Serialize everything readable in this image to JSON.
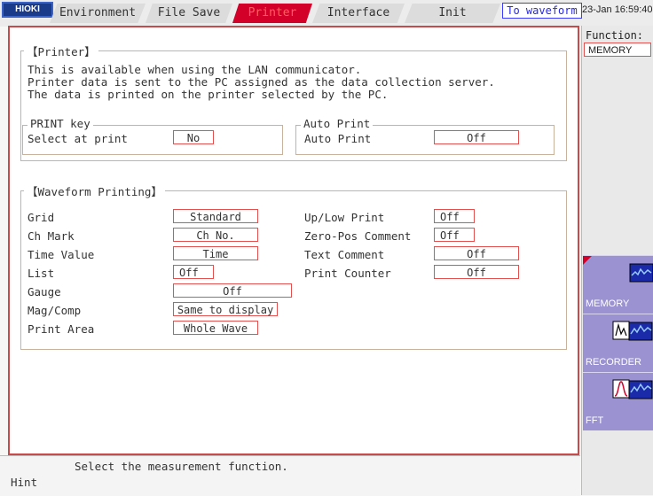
{
  "header": {
    "logo": "HIOKI",
    "tabs": [
      {
        "label": "Environment",
        "active": false
      },
      {
        "label": "File Save",
        "active": false
      },
      {
        "label": "Printer",
        "active": true
      },
      {
        "label": "Interface",
        "active": false
      },
      {
        "label": "Init",
        "active": false
      }
    ],
    "to_waveform": "To waveform",
    "clock": "23-Jan 16:59:40"
  },
  "printer": {
    "title": "【Printer】",
    "desc": [
      "This is available when using the LAN communicator.",
      "Printer data is sent to the PC assigned as the data collection server.",
      "The data is printed on the printer selected by the PC."
    ],
    "print_key": {
      "title": "PRINT key",
      "label": "Select at print",
      "value": "No"
    },
    "auto_print": {
      "title": "Auto Print",
      "label": "Auto Print",
      "value": "Off"
    }
  },
  "waveform": {
    "title": "【Waveform Printing】",
    "left": [
      {
        "label": "Grid",
        "value": "Standard"
      },
      {
        "label": "Ch Mark",
        "value": "Ch No."
      },
      {
        "label": "Time Value",
        "value": "Time"
      },
      {
        "label": "List",
        "value": "Off"
      },
      {
        "label": "Gauge",
        "value": "Off"
      },
      {
        "label": "Mag/Comp",
        "value": "Same to display"
      },
      {
        "label": "Print Area",
        "value": "Whole Wave"
      }
    ],
    "right": [
      {
        "label": "Up/Low Print",
        "value": "Off"
      },
      {
        "label": "Zero-Pos Comment",
        "value": "Off"
      },
      {
        "label": "Text Comment",
        "value": "Off"
      },
      {
        "label": "Print Counter",
        "value": "Off"
      }
    ]
  },
  "sidepanel": {
    "function_label": "Function:",
    "function_value": "MEMORY",
    "buttons": [
      {
        "label": "MEMORY",
        "icon": "memory-waveform-icon"
      },
      {
        "label": "RECORDER",
        "icon": "recorder-waveform-icon"
      },
      {
        "label": "FFT",
        "icon": "fft-spectrum-icon"
      }
    ]
  },
  "hint": {
    "message": "Select the measurement function.",
    "label": "Hint"
  }
}
